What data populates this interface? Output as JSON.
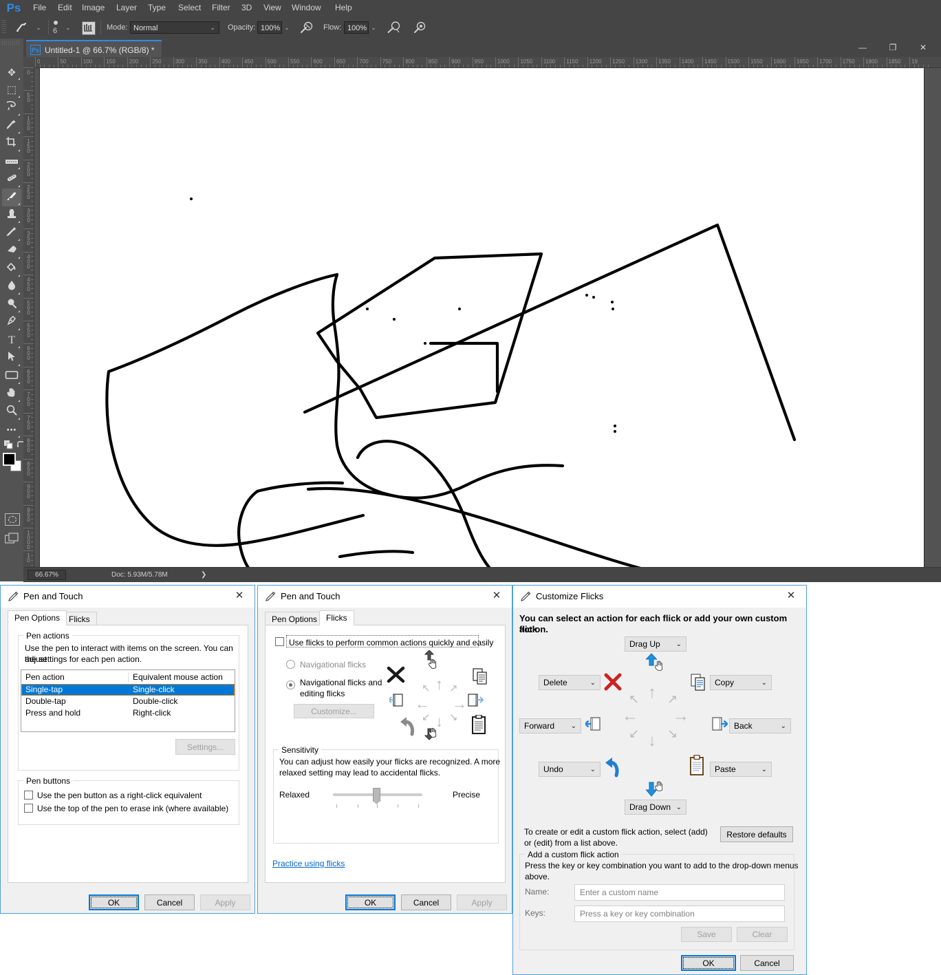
{
  "photoshop": {
    "logo": "Ps",
    "menu": [
      "File",
      "Edit",
      "Image",
      "Layer",
      "Type",
      "Select",
      "Filter",
      "3D",
      "View",
      "Window",
      "Help"
    ],
    "options_bar": {
      "brush_size": "6",
      "mode_label": "Mode:",
      "mode_value": "Normal",
      "opacity_label": "Opacity:",
      "opacity_value": "100%",
      "flow_label": "Flow:",
      "flow_value": "100%"
    },
    "tools": [
      {
        "name": "move-tool",
        "glyph": "✥"
      },
      {
        "name": "rectangular-marquee-tool",
        "glyph": "▭"
      },
      {
        "name": "lasso-tool",
        "glyph": "➷"
      },
      {
        "name": "magic-wand-tool",
        "glyph": "✨"
      },
      {
        "name": "crop-tool",
        "glyph": "⌗"
      },
      {
        "name": "eyedropper-tool",
        "glyph": "▤"
      },
      {
        "name": "spot-healing-brush-tool",
        "glyph": "🩹"
      },
      {
        "name": "brush-tool",
        "glyph": "🖌"
      },
      {
        "name": "clone-stamp-tool",
        "glyph": "⚒"
      },
      {
        "name": "history-brush-tool",
        "glyph": "🖋"
      },
      {
        "name": "eraser-tool",
        "glyph": "◣"
      },
      {
        "name": "gradient-paint-bucket-tool",
        "glyph": "◭"
      },
      {
        "name": "blur-tool",
        "glyph": "💧"
      },
      {
        "name": "dodge-tool",
        "glyph": "🔍"
      },
      {
        "name": "pen-tool",
        "glyph": "✒"
      },
      {
        "name": "horizontal-type-tool",
        "glyph": "T"
      },
      {
        "name": "path-selection-tool",
        "glyph": "➤"
      },
      {
        "name": "rectangle-shape-tool",
        "glyph": "▭"
      },
      {
        "name": "hand-tool",
        "glyph": "✋"
      },
      {
        "name": "zoom-tool",
        "glyph": "🔍"
      },
      {
        "name": "edit-toolbar-tool",
        "glyph": "•••"
      }
    ],
    "document": {
      "tab_title": "Untitled-1 @ 66.7% (RGB/8) *",
      "tab_icon": "Ps"
    },
    "window_buttons": {
      "minimize": "—",
      "maximize": "❐",
      "close": "✕"
    },
    "ruler_h_labels": [
      "0",
      "50",
      "100",
      "150",
      "200",
      "250",
      "300",
      "350",
      "400",
      "450",
      "500",
      "550",
      "600",
      "650",
      "700",
      "750",
      "800",
      "850",
      "900",
      "950",
      "1000",
      "1050",
      "1100",
      "1150",
      "1200",
      "1250",
      "1300",
      "1350",
      "1400",
      "1450",
      "1500",
      "1550",
      "1600",
      "1650",
      "1700",
      "1750",
      "1800",
      "1850",
      "19"
    ],
    "ruler_v_labels": [
      "0",
      "50",
      "100",
      "150",
      "200",
      "250",
      "300",
      "350",
      "400",
      "450",
      "500",
      "550",
      "600",
      "650",
      "700",
      "750",
      "800",
      "850",
      "900",
      "950",
      "1000",
      "10"
    ],
    "status": {
      "zoom": "66.67%",
      "doc_info": "Doc: 5.93M/5.78M",
      "arrow": "❯"
    }
  },
  "dialog_pen_options": {
    "title": "Pen and Touch",
    "close": "✕",
    "tabs": [
      {
        "label": "Pen Options",
        "active": true
      },
      {
        "label": "Flicks",
        "active": false
      }
    ],
    "group_pen_actions": {
      "title": "Pen actions",
      "description_line1": "Use the pen to interact with items on the screen.  You can adjust",
      "description_line2": "the settings for each pen action.",
      "columns": [
        "Pen action",
        "Equivalent mouse action"
      ],
      "rows": [
        {
          "action": "Single-tap",
          "mouse": "Single-click",
          "selected": true
        },
        {
          "action": "Double-tap",
          "mouse": "Double-click",
          "selected": false
        },
        {
          "action": "Press and hold",
          "mouse": "Right-click",
          "selected": false
        }
      ],
      "settings_button": "Settings..."
    },
    "group_pen_buttons": {
      "title": "Pen buttons",
      "checkbox_right_click": "Use the pen button as a right-click equivalent",
      "checkbox_erase_ink": "Use the top of the pen to erase ink (where available)"
    },
    "buttons": {
      "ok": "OK",
      "cancel": "Cancel",
      "apply": "Apply"
    }
  },
  "dialog_flicks": {
    "title": "Pen and Touch",
    "close": "✕",
    "tabs": [
      {
        "label": "Pen Options",
        "active": false
      },
      {
        "label": "Flicks",
        "active": true
      }
    ],
    "use_flicks_checkbox": "Use flicks to perform common actions quickly and easily",
    "radio_navigational": "Navigational flicks",
    "radio_nav_editing_line1": "Navigational flicks and",
    "radio_nav_editing_line2": "editing flicks",
    "customize_button": "Customize...",
    "group_sensitivity": {
      "title": "Sensitivity",
      "description_line1": "You can adjust how easily your flicks are recognized. A more",
      "description_line2": "relaxed setting may lead to accidental flicks.",
      "min_label": "Relaxed",
      "max_label": "Precise",
      "value": 50
    },
    "practice_link": "Practice using flicks",
    "buttons": {
      "ok": "OK",
      "cancel": "Cancel",
      "apply": "Apply"
    }
  },
  "dialog_customize_flicks": {
    "title": "Customize Flicks",
    "close": "✕",
    "intro_line1": "You can select an action for each flick or add your own custom flick",
    "intro_line2": "action.",
    "dropdowns": {
      "up": "Drag Up",
      "down": "Drag Down",
      "left_upper": "Delete",
      "right_upper": "Copy",
      "left_mid": "Forward",
      "right_mid": "Back",
      "left_lower": "Undo",
      "right_lower": "Paste"
    },
    "hint_line1": "To create or edit a custom flick action, select (add)",
    "hint_line2": "or (edit) from a list above.",
    "restore_defaults_button": "Restore defaults",
    "group_add_custom": {
      "title": "Add a custom flick action",
      "description_line1": "Press the key or key combination you want to add to the drop-down menus",
      "description_line2": "above.",
      "name_label": "Name:",
      "name_placeholder": "Enter a custom name",
      "keys_label": "Keys:",
      "keys_placeholder": "Press a key or key combination",
      "save_button": "Save",
      "clear_button": "Clear"
    },
    "buttons": {
      "ok": "OK",
      "cancel": "Cancel"
    }
  },
  "colors": {
    "accent_blue": "#0078d7",
    "ps_panel": "#535353",
    "ps_chrome": "#454545",
    "ps_logo_blue": "#2d8ceb",
    "selection_blue": "#0078d7",
    "link_blue": "#0066cc",
    "delete_red": "#cc2222",
    "flick_arrow_blue": "#1e90e0"
  }
}
